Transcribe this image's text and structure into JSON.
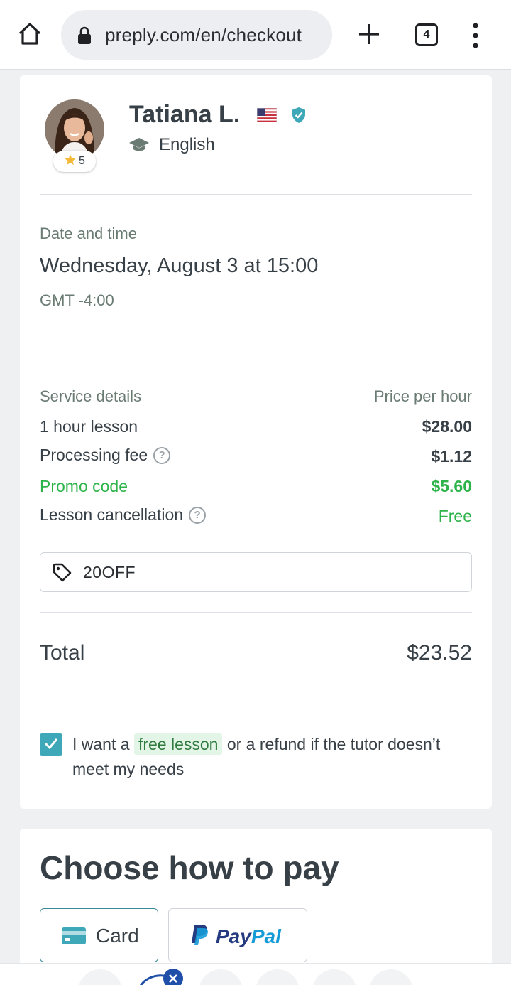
{
  "browser": {
    "url": "preply.com/en/checkout",
    "tab_count": "4"
  },
  "tutor": {
    "name": "Tatiana L.",
    "rating": "5",
    "subject": "English"
  },
  "datetime": {
    "label": "Date and time",
    "value": "Wednesday, August 3 at 15:00",
    "timezone": "GMT -4:00"
  },
  "service": {
    "header_left": "Service details",
    "header_right": "Price per hour",
    "rows": [
      {
        "label": "1 hour lesson",
        "value": "$28.00"
      },
      {
        "label": "Processing fee",
        "value": "$1.12"
      },
      {
        "label": "Promo code",
        "value": "$5.60"
      },
      {
        "label": "Lesson cancellation",
        "value": "Free"
      }
    ]
  },
  "promo": {
    "code": "20OFF"
  },
  "total": {
    "label": "Total",
    "value": "$23.52"
  },
  "guarantee": {
    "checked": true,
    "before": "I want a",
    "highlight": "free lesson",
    "after": "or a refund if the tutor doesn’t meet my needs"
  },
  "payment": {
    "title": "Choose how to pay",
    "card_label": "Card",
    "paypal_label": "PayPal"
  },
  "colors": {
    "accent": "#3fa8b8",
    "green": "#2db34a",
    "text": "#384047",
    "muted": "#6a7b73",
    "paypal_dark": "#253b80",
    "paypal_light": "#179bd7"
  }
}
